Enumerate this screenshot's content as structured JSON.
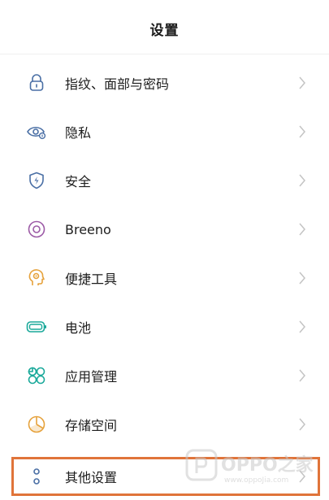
{
  "header": {
    "title": "设置"
  },
  "settings": {
    "items": [
      {
        "label": "指纹、面部与密码",
        "icon": "lock-icon"
      },
      {
        "label": "隐私",
        "icon": "privacy-eye-icon"
      },
      {
        "label": "安全",
        "icon": "shield-icon"
      },
      {
        "label": "Breeno",
        "icon": "breeno-icon"
      },
      {
        "label": "便捷工具",
        "icon": "convenience-tools-icon"
      },
      {
        "label": "电池",
        "icon": "battery-icon"
      },
      {
        "label": "应用管理",
        "icon": "apps-icon"
      },
      {
        "label": "存储空间",
        "icon": "storage-pie-icon"
      },
      {
        "label": "其他设置",
        "icon": "more-settings-icon"
      }
    ]
  },
  "watermark": {
    "brand": "OPPO之家",
    "url": "www.oppoJia.com"
  },
  "colors": {
    "icon_blue": "#4a6fa5",
    "icon_teal": "#1aa99a",
    "icon_purple": "#9c5aa6",
    "icon_orange": "#e6a23c",
    "highlight": "#e0743a",
    "chevron": "#c4c4c4"
  }
}
